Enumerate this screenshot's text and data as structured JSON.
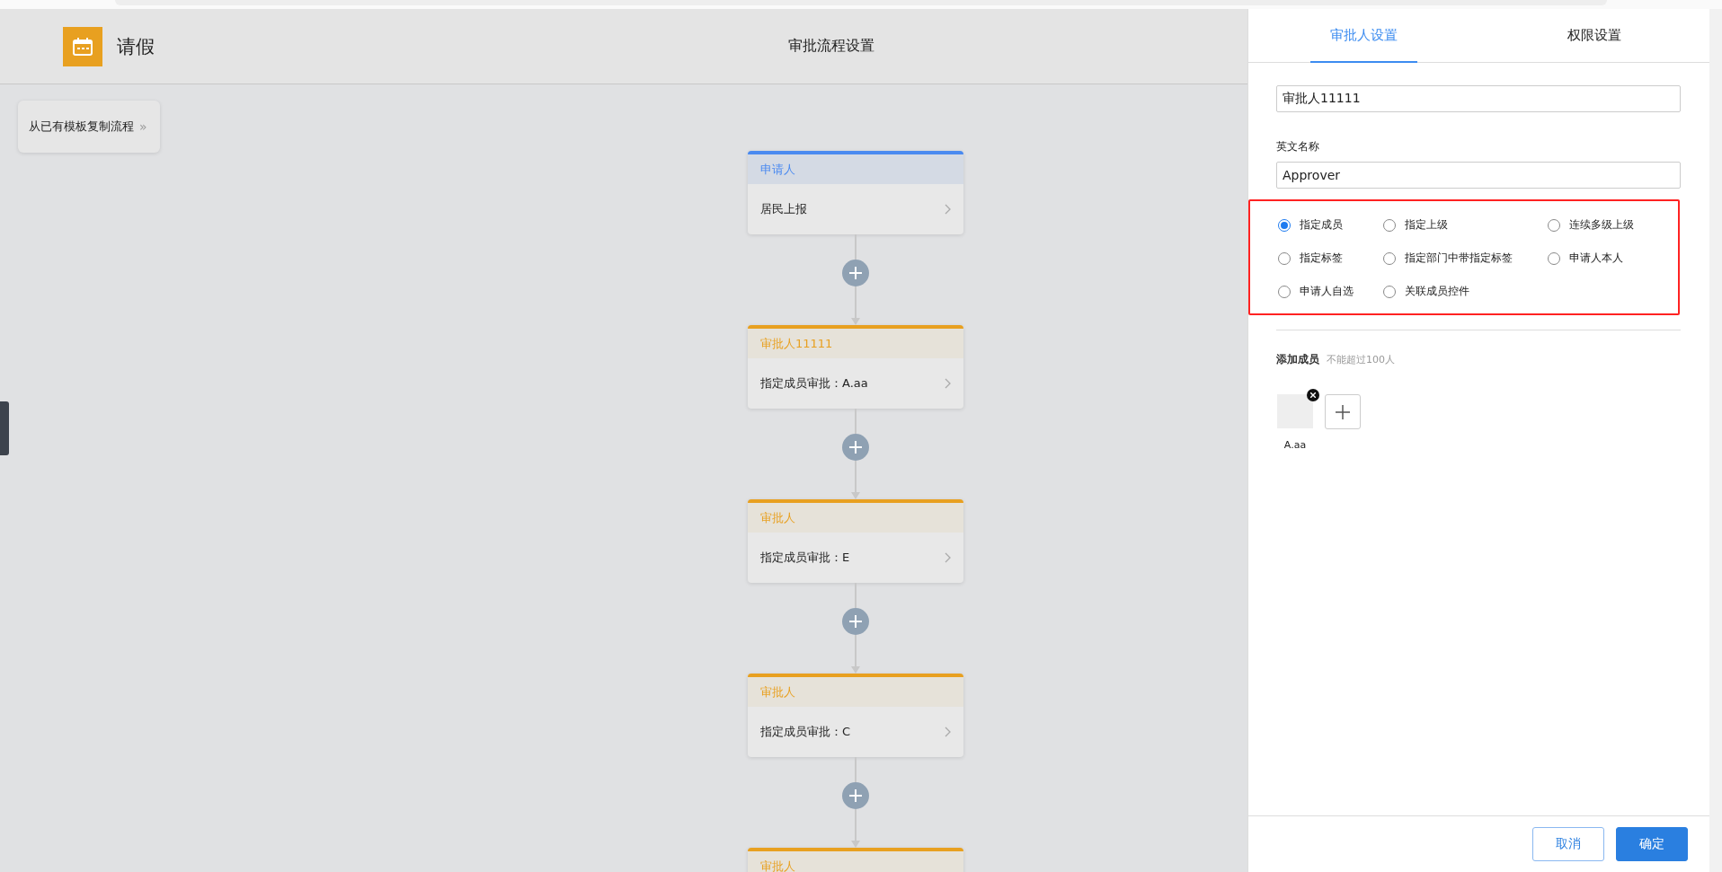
{
  "header": {
    "title": "请假",
    "center_title": "审批流程设置"
  },
  "copy_button": {
    "label": "从已有模板复制流程",
    "caret": "»"
  },
  "flow": [
    {
      "kind": "applicant",
      "title": "申请人",
      "content": "居民上报"
    },
    {
      "kind": "approver",
      "title": "审批人11111",
      "content": "指定成员审批：A.aa"
    },
    {
      "kind": "approver",
      "title": "审批人",
      "content": "指定成员审批：E"
    },
    {
      "kind": "approver",
      "title": "审批人",
      "content": "指定成员审批：C"
    },
    {
      "kind": "approver",
      "title": "审批人"
    }
  ],
  "panel": {
    "tabs": [
      {
        "label": "审批人设置",
        "selected": true
      },
      {
        "label": "权限设置",
        "selected": false
      }
    ],
    "name_field": {
      "value": "审批人11111"
    },
    "english_name": {
      "label": "英文名称",
      "value": "Approver"
    },
    "options": [
      {
        "label": "指定成员",
        "selected": true
      },
      {
        "label": "指定上级",
        "selected": false
      },
      {
        "label": "连续多级上级",
        "selected": false
      },
      {
        "label": "指定标签",
        "selected": false
      },
      {
        "label": "指定部门中带指定标签",
        "selected": false
      },
      {
        "label": "申请人本人",
        "selected": false
      },
      {
        "label": "申请人自选",
        "selected": false
      },
      {
        "label": "关联成员控件",
        "selected": false
      }
    ],
    "members": {
      "label": "添加成员",
      "hint": "不能超过100人",
      "items": [
        {
          "name": "A.aa"
        }
      ]
    },
    "buttons": [
      {
        "kind": "secondary",
        "label": "取消"
      },
      {
        "kind": "primary",
        "label": "确定"
      }
    ]
  }
}
